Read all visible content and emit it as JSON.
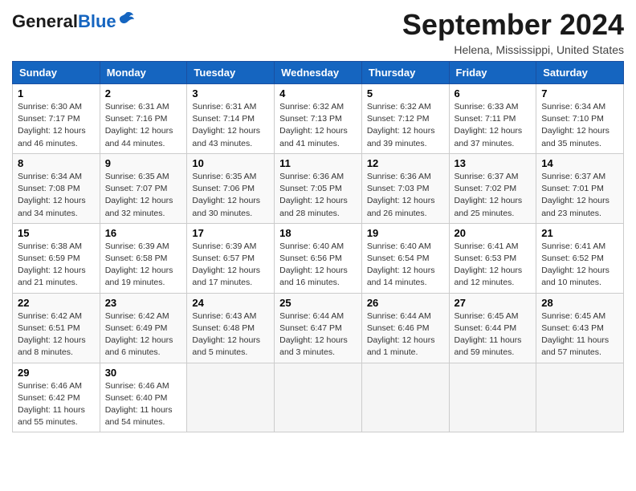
{
  "header": {
    "logo_general": "General",
    "logo_blue": "Blue",
    "month_year": "September 2024",
    "location": "Helena, Mississippi, United States"
  },
  "weekdays": [
    "Sunday",
    "Monday",
    "Tuesday",
    "Wednesday",
    "Thursday",
    "Friday",
    "Saturday"
  ],
  "weeks": [
    [
      {
        "day": "1",
        "lines": [
          "Sunrise: 6:30 AM",
          "Sunset: 7:17 PM",
          "Daylight: 12 hours",
          "and 46 minutes."
        ]
      },
      {
        "day": "2",
        "lines": [
          "Sunrise: 6:31 AM",
          "Sunset: 7:16 PM",
          "Daylight: 12 hours",
          "and 44 minutes."
        ]
      },
      {
        "day": "3",
        "lines": [
          "Sunrise: 6:31 AM",
          "Sunset: 7:14 PM",
          "Daylight: 12 hours",
          "and 43 minutes."
        ]
      },
      {
        "day": "4",
        "lines": [
          "Sunrise: 6:32 AM",
          "Sunset: 7:13 PM",
          "Daylight: 12 hours",
          "and 41 minutes."
        ]
      },
      {
        "day": "5",
        "lines": [
          "Sunrise: 6:32 AM",
          "Sunset: 7:12 PM",
          "Daylight: 12 hours",
          "and 39 minutes."
        ]
      },
      {
        "day": "6",
        "lines": [
          "Sunrise: 6:33 AM",
          "Sunset: 7:11 PM",
          "Daylight: 12 hours",
          "and 37 minutes."
        ]
      },
      {
        "day": "7",
        "lines": [
          "Sunrise: 6:34 AM",
          "Sunset: 7:10 PM",
          "Daylight: 12 hours",
          "and 35 minutes."
        ]
      }
    ],
    [
      {
        "day": "8",
        "lines": [
          "Sunrise: 6:34 AM",
          "Sunset: 7:08 PM",
          "Daylight: 12 hours",
          "and 34 minutes."
        ]
      },
      {
        "day": "9",
        "lines": [
          "Sunrise: 6:35 AM",
          "Sunset: 7:07 PM",
          "Daylight: 12 hours",
          "and 32 minutes."
        ]
      },
      {
        "day": "10",
        "lines": [
          "Sunrise: 6:35 AM",
          "Sunset: 7:06 PM",
          "Daylight: 12 hours",
          "and 30 minutes."
        ]
      },
      {
        "day": "11",
        "lines": [
          "Sunrise: 6:36 AM",
          "Sunset: 7:05 PM",
          "Daylight: 12 hours",
          "and 28 minutes."
        ]
      },
      {
        "day": "12",
        "lines": [
          "Sunrise: 6:36 AM",
          "Sunset: 7:03 PM",
          "Daylight: 12 hours",
          "and 26 minutes."
        ]
      },
      {
        "day": "13",
        "lines": [
          "Sunrise: 6:37 AM",
          "Sunset: 7:02 PM",
          "Daylight: 12 hours",
          "and 25 minutes."
        ]
      },
      {
        "day": "14",
        "lines": [
          "Sunrise: 6:37 AM",
          "Sunset: 7:01 PM",
          "Daylight: 12 hours",
          "and 23 minutes."
        ]
      }
    ],
    [
      {
        "day": "15",
        "lines": [
          "Sunrise: 6:38 AM",
          "Sunset: 6:59 PM",
          "Daylight: 12 hours",
          "and 21 minutes."
        ]
      },
      {
        "day": "16",
        "lines": [
          "Sunrise: 6:39 AM",
          "Sunset: 6:58 PM",
          "Daylight: 12 hours",
          "and 19 minutes."
        ]
      },
      {
        "day": "17",
        "lines": [
          "Sunrise: 6:39 AM",
          "Sunset: 6:57 PM",
          "Daylight: 12 hours",
          "and 17 minutes."
        ]
      },
      {
        "day": "18",
        "lines": [
          "Sunrise: 6:40 AM",
          "Sunset: 6:56 PM",
          "Daylight: 12 hours",
          "and 16 minutes."
        ]
      },
      {
        "day": "19",
        "lines": [
          "Sunrise: 6:40 AM",
          "Sunset: 6:54 PM",
          "Daylight: 12 hours",
          "and 14 minutes."
        ]
      },
      {
        "day": "20",
        "lines": [
          "Sunrise: 6:41 AM",
          "Sunset: 6:53 PM",
          "Daylight: 12 hours",
          "and 12 minutes."
        ]
      },
      {
        "day": "21",
        "lines": [
          "Sunrise: 6:41 AM",
          "Sunset: 6:52 PM",
          "Daylight: 12 hours",
          "and 10 minutes."
        ]
      }
    ],
    [
      {
        "day": "22",
        "lines": [
          "Sunrise: 6:42 AM",
          "Sunset: 6:51 PM",
          "Daylight: 12 hours",
          "and 8 minutes."
        ]
      },
      {
        "day": "23",
        "lines": [
          "Sunrise: 6:42 AM",
          "Sunset: 6:49 PM",
          "Daylight: 12 hours",
          "and 6 minutes."
        ]
      },
      {
        "day": "24",
        "lines": [
          "Sunrise: 6:43 AM",
          "Sunset: 6:48 PM",
          "Daylight: 12 hours",
          "and 5 minutes."
        ]
      },
      {
        "day": "25",
        "lines": [
          "Sunrise: 6:44 AM",
          "Sunset: 6:47 PM",
          "Daylight: 12 hours",
          "and 3 minutes."
        ]
      },
      {
        "day": "26",
        "lines": [
          "Sunrise: 6:44 AM",
          "Sunset: 6:46 PM",
          "Daylight: 12 hours",
          "and 1 minute."
        ]
      },
      {
        "day": "27",
        "lines": [
          "Sunrise: 6:45 AM",
          "Sunset: 6:44 PM",
          "Daylight: 11 hours",
          "and 59 minutes."
        ]
      },
      {
        "day": "28",
        "lines": [
          "Sunrise: 6:45 AM",
          "Sunset: 6:43 PM",
          "Daylight: 11 hours",
          "and 57 minutes."
        ]
      }
    ],
    [
      {
        "day": "29",
        "lines": [
          "Sunrise: 6:46 AM",
          "Sunset: 6:42 PM",
          "Daylight: 11 hours",
          "and 55 minutes."
        ]
      },
      {
        "day": "30",
        "lines": [
          "Sunrise: 6:46 AM",
          "Sunset: 6:40 PM",
          "Daylight: 11 hours",
          "and 54 minutes."
        ]
      },
      null,
      null,
      null,
      null,
      null
    ]
  ]
}
